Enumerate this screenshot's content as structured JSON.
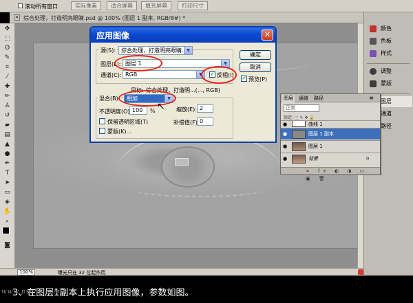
{
  "options_bar": {
    "scroll_all_windows_label": "滚动所有窗口",
    "actual_pixels_label": "实际像素",
    "fit_screen_label": "适合屏幕",
    "fill_screen_label": "填充屏幕",
    "print_size_label": "打印尺寸"
  },
  "document": {
    "tab_title": "综合处理，打造明亮眼睛.psd @ 100% (图层 1 副本, RGB/8#) *",
    "close_label": "×"
  },
  "status_bar": {
    "zoom": "100%",
    "info": "曝光只在 32 位起作用"
  },
  "right_panel": {
    "items": [
      {
        "label": "颜色",
        "icon": "color-icon"
      },
      {
        "label": "色板",
        "icon": "swatches-icon"
      },
      {
        "label": "样式",
        "icon": "styles-icon"
      },
      {
        "label": "调整",
        "icon": "adjustments-icon"
      },
      {
        "label": "蒙版",
        "icon": "masks-icon"
      },
      {
        "label": "图层",
        "icon": "layers-icon"
      },
      {
        "label": "通道",
        "icon": "channels-icon"
      },
      {
        "label": "路径",
        "icon": "paths-icon"
      }
    ],
    "selected": "图层"
  },
  "layers_panel": {
    "tabs": [
      "图层",
      "通道",
      "路径"
    ],
    "blend_mode": "正常",
    "locks_label": "锁定:  ⬚ ✎ ✥ 🔒",
    "layers": [
      {
        "name": "曲线 1",
        "visible": true
      },
      {
        "name": "图层 1 副本",
        "visible": true,
        "selected": true
      },
      {
        "name": "图层 1",
        "visible": true
      },
      {
        "name": "背景",
        "visible": true,
        "locked": true
      }
    ],
    "footer_icons": "∞ fx ◐ ◑ ▭ ▣ 🗑"
  },
  "dialog": {
    "title": "应用图像",
    "source_label": "源(S):",
    "source_value": "综合处理，打造明亮眼睛...",
    "layer_label": "图层(L):",
    "layer_value": "图层 1",
    "channel_label": "通道(C):",
    "channel_value": "RGB",
    "invert_label": "反相(I)",
    "invert_checked": true,
    "target_label": "目标:",
    "target_value": "综合处理，打造明...(..., RGB)",
    "blending_label": "混合(B):",
    "blending_value": "相加",
    "opacity_label": "不透明度(O):",
    "opacity_value": "100",
    "opacity_unit": "%",
    "scale_label": "缩放(E):",
    "scale_value": "2",
    "offset_label": "补偿值(F):",
    "offset_value": "0",
    "preserve_transparency_label": "保留透明区域(T)",
    "mask_label": "蒙版(K)...",
    "ok_label": "确定",
    "cancel_label": "取消",
    "preview_label": "预览(P)",
    "preview_checked": true
  },
  "caption": {
    "text": "3、在图层1副本上执行应用图像，参数如图。",
    "watermark": "www.psahz.com"
  },
  "colors": {
    "dialog_title_blue": "#0a49d0",
    "highlight_ring": "#e8221b",
    "selected_layer": "#3d6fba"
  }
}
